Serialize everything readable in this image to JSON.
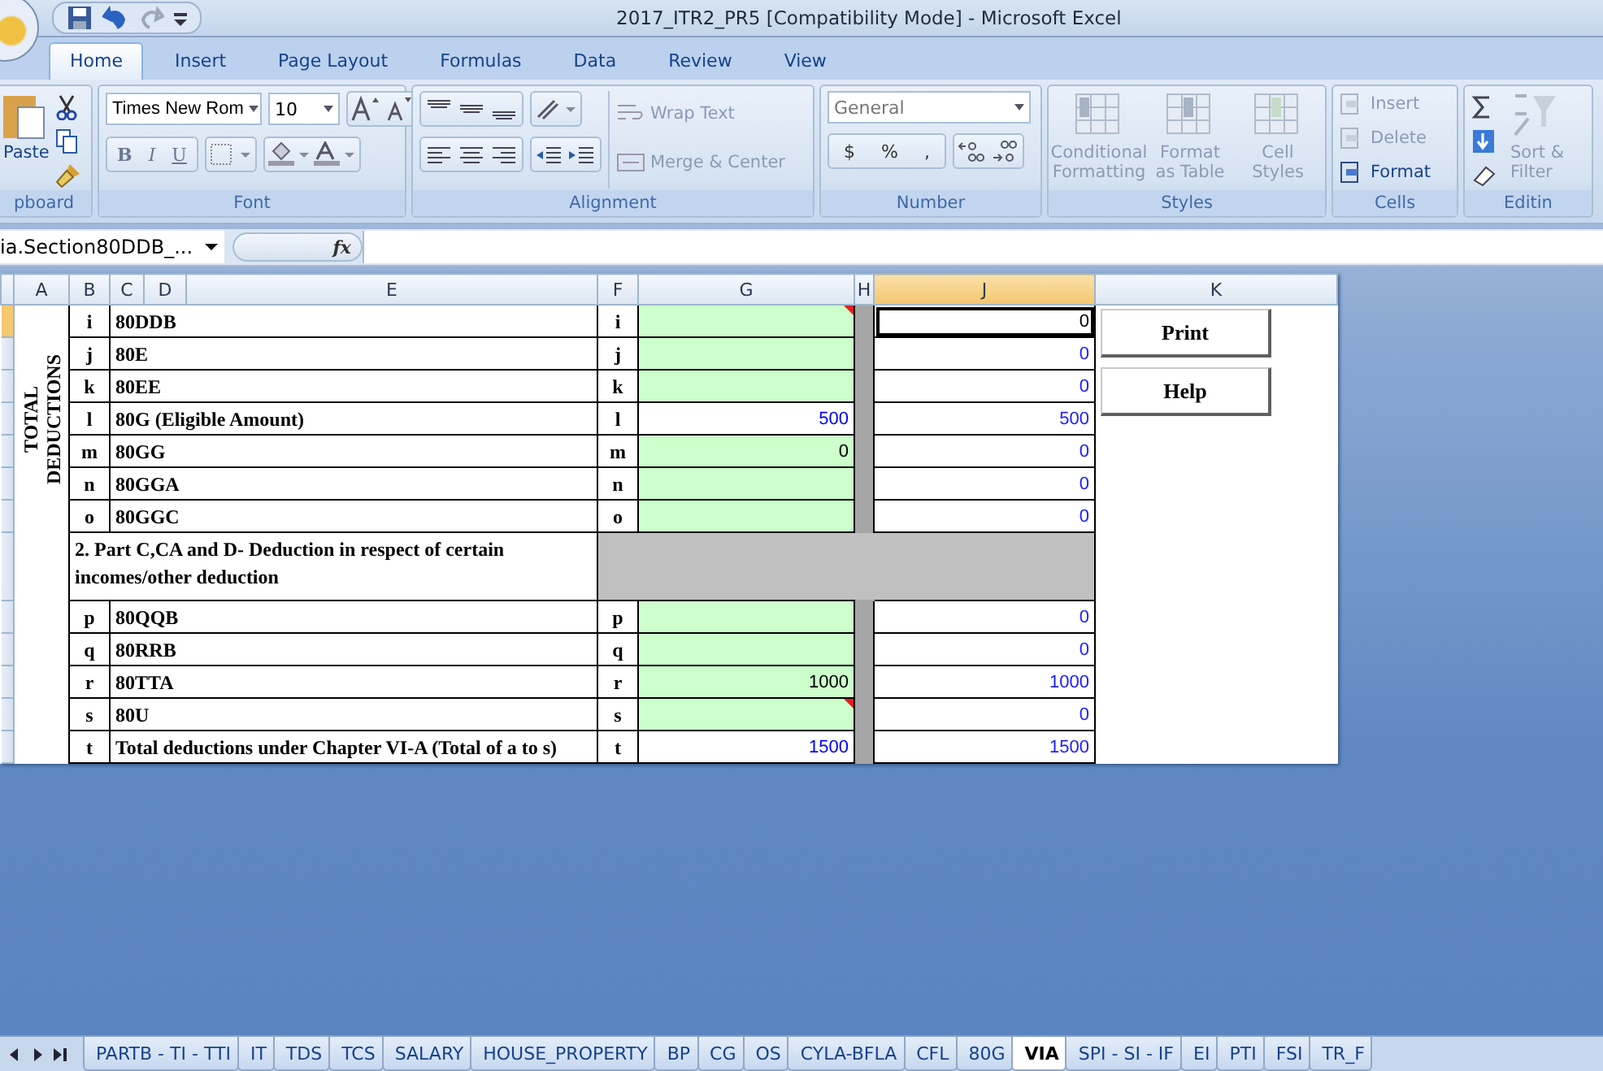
{
  "window": {
    "title": "2017_ITR2_PR5  [Compatibility Mode] - Microsoft Excel"
  },
  "ribbon_tabs": [
    {
      "label": "Home",
      "selected": true
    },
    {
      "label": "Insert",
      "selected": false
    },
    {
      "label": "Page Layout",
      "selected": false
    },
    {
      "label": "Formulas",
      "selected": false
    },
    {
      "label": "Data",
      "selected": false
    },
    {
      "label": "Review",
      "selected": false
    },
    {
      "label": "View",
      "selected": false
    }
  ],
  "ribbon": {
    "clipboard": {
      "label": "pboard",
      "paste": "Paste"
    },
    "font": {
      "label": "Font",
      "font_name": "Times New Rom",
      "font_size": "10",
      "styles": [
        "B",
        "I",
        "U"
      ]
    },
    "alignment": {
      "label": "Alignment",
      "wrap": "Wrap Text",
      "merge": "Merge & Center"
    },
    "number": {
      "label": "Number",
      "format": "General",
      "buttons": [
        "$",
        "%",
        ","
      ]
    },
    "styles": {
      "label": "Styles",
      "buttons": [
        "Conditional Formatting",
        "Format as Table",
        "Cell Styles"
      ]
    },
    "cells": {
      "label": "Cells",
      "buttons": [
        {
          "label": "Insert",
          "disabled": true
        },
        {
          "label": "Delete",
          "disabled": true
        },
        {
          "label": "Format",
          "disabled": false
        }
      ]
    },
    "editing": {
      "label": "Editin",
      "sort": "Sort & Filter"
    }
  },
  "formula_bar": {
    "name_box": "ia.Section80DDB_...",
    "fx": "fx"
  },
  "columns": [
    {
      "label": "A",
      "selected": false
    },
    {
      "label": "B",
      "selected": false
    },
    {
      "label": "C",
      "selected": false
    },
    {
      "label": "D",
      "selected": false
    },
    {
      "label": "E",
      "selected": false
    },
    {
      "label": "F",
      "selected": false
    },
    {
      "label": "G",
      "selected": false
    },
    {
      "label": "H",
      "selected": false
    },
    {
      "label": "J",
      "selected": true
    },
    {
      "label": "K",
      "selected": false
    }
  ],
  "side_label": "TOTAL DEDUCTIONS",
  "rows": [
    {
      "kind": "item",
      "letter": "i",
      "label": "80DDB",
      "letter2": "i",
      "amount": {
        "editable": true,
        "comment": true
      },
      "total": {
        "value": "0",
        "selected": true
      }
    },
    {
      "kind": "item",
      "letter": "j",
      "label": "80E",
      "letter2": "j",
      "amount": {
        "editable": true
      },
      "total": {
        "value": "0",
        "selected": false
      }
    },
    {
      "kind": "item",
      "letter": "k",
      "label": "80EE",
      "letter2": "k",
      "amount": {
        "editable": true
      },
      "total": {
        "value": "0",
        "selected": false
      }
    },
    {
      "kind": "item",
      "letter": "l",
      "label": "80G (Eligible Amount)",
      "letter2": "l",
      "amount": {
        "value": "500",
        "editable": false
      },
      "total": {
        "value": "500",
        "selected": false
      }
    },
    {
      "kind": "item",
      "letter": "m",
      "label": "80GG",
      "letter2": "m",
      "amount": {
        "value": "0",
        "editable": true
      },
      "total": {
        "value": "0",
        "selected": false
      }
    },
    {
      "kind": "item",
      "letter": "n",
      "label": "80GGA",
      "letter2": "n",
      "amount": {
        "editable": true
      },
      "total": {
        "value": "0",
        "selected": false
      }
    },
    {
      "kind": "item",
      "letter": "o",
      "label": "80GGC",
      "letter2": "o",
      "amount": {
        "editable": true
      },
      "total": {
        "value": "0",
        "selected": false
      }
    },
    {
      "kind": "section",
      "text": "2. Part C,CA and D- Deduction in respect of certain incomes/other deduction"
    },
    {
      "kind": "item",
      "letter": "p",
      "label": "80QQB",
      "letter2": "p",
      "amount": {
        "editable": true
      },
      "total": {
        "value": "0",
        "selected": false
      }
    },
    {
      "kind": "item",
      "letter": "q",
      "label": "80RRB",
      "letter2": "q",
      "amount": {
        "editable": true
      },
      "total": {
        "value": "0",
        "selected": false
      }
    },
    {
      "kind": "item",
      "letter": "r",
      "label": "80TTA",
      "letter2": "r",
      "amount": {
        "value": "1000",
        "editable": true
      },
      "total": {
        "value": "1000",
        "selected": false
      }
    },
    {
      "kind": "item",
      "letter": "s",
      "label": "80U",
      "letter2": "s",
      "amount": {
        "editable": true,
        "comment": true
      },
      "total": {
        "value": "0",
        "selected": false
      }
    },
    {
      "kind": "item",
      "letter": "t",
      "label": "Total deductions under Chapter VI-A (Total of a to s)",
      "letter2": "t",
      "amount": {
        "value": "1500",
        "editable": false
      },
      "total": {
        "value": "1500",
        "selected": false
      }
    }
  ],
  "buttons": [
    "Print",
    "Help"
  ],
  "sheet_tabs": [
    {
      "label": "PARTB - TI - TTI",
      "selected": false
    },
    {
      "label": "IT",
      "selected": false
    },
    {
      "label": "TDS",
      "selected": false
    },
    {
      "label": "TCS",
      "selected": false
    },
    {
      "label": "SALARY",
      "selected": false
    },
    {
      "label": "HOUSE_PROPERTY",
      "selected": false
    },
    {
      "label": "BP",
      "selected": false
    },
    {
      "label": "CG",
      "selected": false
    },
    {
      "label": "OS",
      "selected": false
    },
    {
      "label": "CYLA-BFLA",
      "selected": false
    },
    {
      "label": "CFL",
      "selected": false
    },
    {
      "label": "80G",
      "selected": false
    },
    {
      "label": "VIA",
      "selected": true
    },
    {
      "label": "SPI - SI - IF",
      "selected": false
    },
    {
      "label": "EI",
      "selected": false
    },
    {
      "label": "PTI",
      "selected": false
    },
    {
      "label": "FSI",
      "selected": false
    },
    {
      "label": "TR_F",
      "selected": false
    }
  ]
}
